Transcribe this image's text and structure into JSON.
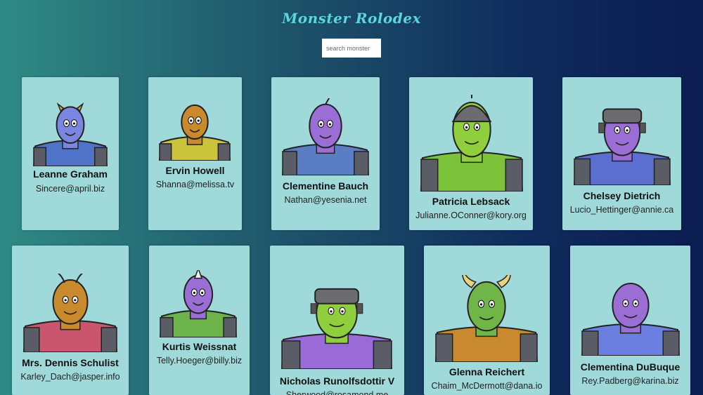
{
  "app": {
    "title": "Monster Rolodex"
  },
  "search": {
    "placeholder": "search monsters",
    "value": ""
  },
  "monsters": [
    {
      "name": "Leanne Graham",
      "email": "Sincere@april.biz",
      "skin": "#7a86e0",
      "body": "#4f73c8"
    },
    {
      "name": "Ervin Howell",
      "email": "Shanna@melissa.tv",
      "skin": "#c98a2e",
      "body": "#c9c43a"
    },
    {
      "name": "Clementine Bauch",
      "email": "Nathan@yesenia.net",
      "skin": "#9b6ed6",
      "body": "#5a7dc4"
    },
    {
      "name": "Patricia Lebsack",
      "email": "Julianne.OConner@kory.org",
      "skin": "#8fcf3e",
      "body": "#7cc23a"
    },
    {
      "name": "Chelsey Dietrich",
      "email": "Lucio_Hettinger@annie.ca",
      "skin": "#9b6ed6",
      "body": "#5a6fd0"
    },
    {
      "name": "Mrs. Dennis Schulist",
      "email": "Karley_Dach@jasper.info",
      "skin": "#c98a2e",
      "body": "#c9556e"
    },
    {
      "name": "Kurtis Weissnat",
      "email": "Telly.Hoeger@billy.biz",
      "skin": "#9b6ed6",
      "body": "#6bb34a"
    },
    {
      "name": "Nicholas Runolfsdottir V",
      "email": "Sherwood@rosamond.me",
      "skin": "#8fcf3e",
      "body": "#9a6ad6"
    },
    {
      "name": "Glenna Reichert",
      "email": "Chaim_McDermott@dana.io",
      "skin": "#6fb548",
      "body": "#c9892e"
    },
    {
      "name": "Clementina DuBuque",
      "email": "Rey.Padberg@karina.biz",
      "skin": "#9b6ed6",
      "body": "#6a7fe0"
    }
  ]
}
